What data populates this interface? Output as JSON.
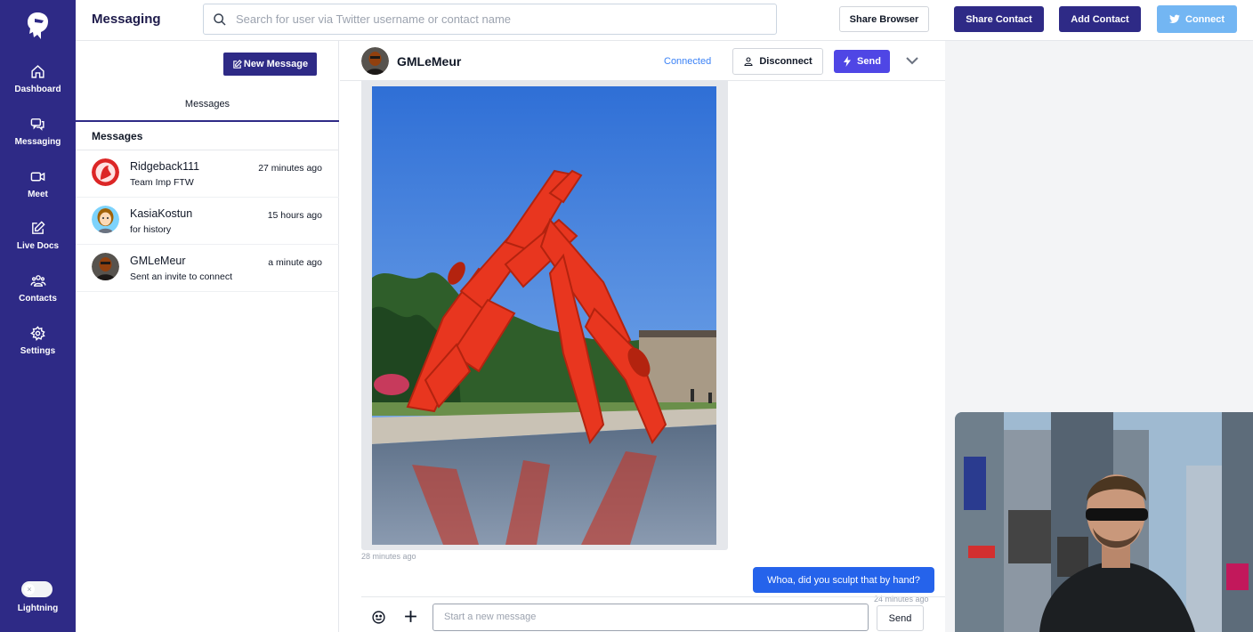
{
  "nav": {
    "items": [
      {
        "label": "Dashboard",
        "icon": "home-icon"
      },
      {
        "label": "Messaging",
        "icon": "chat-icon"
      },
      {
        "label": "Meet",
        "icon": "video-icon"
      },
      {
        "label": "Live Docs",
        "icon": "edit-icon"
      },
      {
        "label": "Contacts",
        "icon": "users-icon"
      },
      {
        "label": "Settings",
        "icon": "gear-icon"
      }
    ],
    "toggle_label": "Lightning",
    "toggle_on": false
  },
  "header": {
    "title": "Messaging",
    "search_placeholder": "Search for user via Twitter username or contact name",
    "share_browser": "Share Browser",
    "share_contact": "Share Contact",
    "add_contact": "Add Contact",
    "connect": "Connect"
  },
  "list": {
    "new_message": "New Message",
    "tab": "Messages",
    "heading": "Messages",
    "conversations": [
      {
        "name": "Ridgeback111",
        "time": "27 minutes ago",
        "preview": "Team Imp FTW"
      },
      {
        "name": "KasiaKostun",
        "time": "15 hours ago",
        "preview": "for history"
      },
      {
        "name": "GMLeMeur",
        "time": "a minute ago",
        "preview": "Sent an invite to connect"
      }
    ]
  },
  "chat": {
    "contact_name": "GMLeMeur",
    "status": "Connected",
    "disconnect": "Disconnect",
    "send_header": "Send",
    "photo_timestamp": "28 minutes ago",
    "outgoing_message": "Whoa, did you sculpt that by hand?",
    "outgoing_timestamp": "24 minutes ago",
    "input_placeholder": "Start a new message",
    "send": "Send"
  },
  "colors": {
    "nav_bg": "#2e2a86",
    "accent": "#4f46e5",
    "bubble": "#2563eb",
    "twitter": "#73b6f3",
    "connected": "#3b82f6"
  }
}
